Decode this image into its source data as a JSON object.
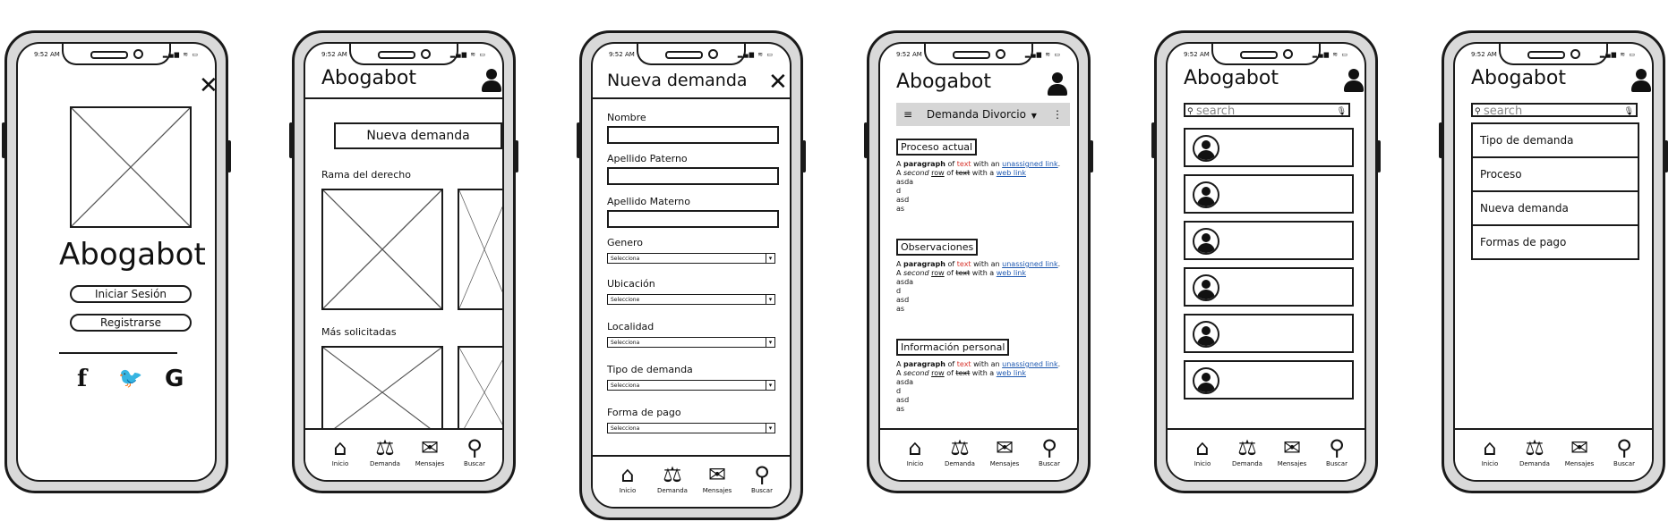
{
  "status": {
    "time": "9:52 AM",
    "icons": "▂▄▆ ≋ ▭"
  },
  "nav": [
    {
      "label": "Inicio",
      "icon": "⌂"
    },
    {
      "label": "Demanda",
      "icon": "⚖"
    },
    {
      "label": "Mensajes",
      "icon": "✉"
    },
    {
      "label": "Buscar",
      "icon": "⚲"
    }
  ],
  "s1": {
    "title": "Abogabot",
    "login": "Iniciar Sesión",
    "register": "Registrarse",
    "social": [
      "f",
      "🐦",
      "G"
    ]
  },
  "s2": {
    "title": "Abogabot",
    "new_button": "Nueva demanda",
    "section1": "Rama del derecho",
    "section2": "Más solicitadas"
  },
  "s3": {
    "title": "Nueva demanda",
    "labels": [
      "Nombre",
      "Apellido Paterno",
      "Apellido Materno",
      "Genero",
      "Ubicación",
      "Localidad",
      "Tipo de demanda",
      "Forma de pago"
    ],
    "select_value": "Selecciona",
    "select_value_alt": "Seleccione"
  },
  "s4": {
    "title": "Abogabot",
    "toolbar": "Demanda Divorcio",
    "sections": [
      "Proceso actual",
      "Observaciones",
      "Información personal"
    ],
    "p": {
      "a": "A ",
      "bold": "paragraph",
      "of": " of ",
      "text": "text",
      "with": " with an ",
      "link1": "unassigned link",
      "dot": ".",
      "line2a": "A ",
      "second": "second",
      "row": "row",
      "text2": "text",
      "with2": " with a ",
      "link2": "web link",
      "l3": "asda",
      "l4": "d",
      "l5": "asd",
      "l6": "as"
    }
  },
  "s5": {
    "title": "Abogabot",
    "search_placeholder": "search"
  },
  "s6": {
    "title": "Abogabot",
    "search_placeholder": "search",
    "menu": [
      "Tipo de demanda",
      "Proceso",
      "Nueva demanda",
      "Formas de pago"
    ]
  }
}
